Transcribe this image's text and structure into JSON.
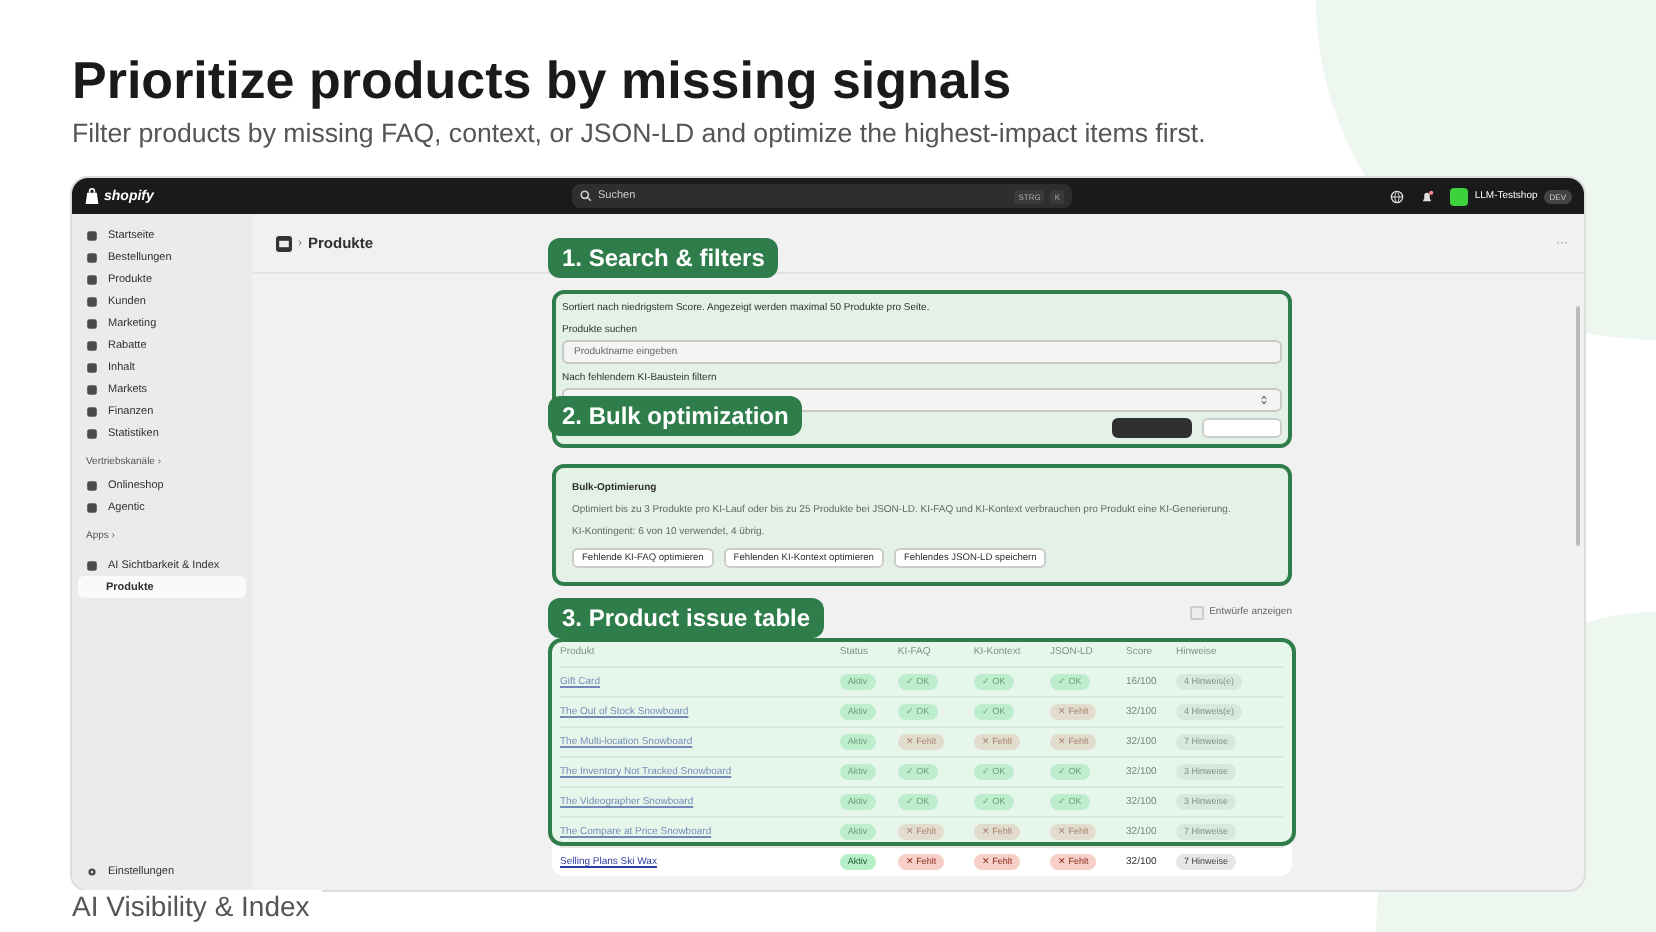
{
  "header": {
    "title": "Prioritize products by missing signals",
    "subtitle": "Filter products by missing FAQ, context, or JSON-LD and optimize the highest-impact items first."
  },
  "topbar": {
    "logo": "shopify",
    "search_placeholder": "Suchen",
    "shortcut": [
      "STRG",
      "K"
    ],
    "store": "LLM-Testshop",
    "store_badge": "DEV"
  },
  "sidebar": {
    "items": [
      {
        "label": "Startseite",
        "selected": false
      },
      {
        "label": "Bestellungen",
        "selected": false
      },
      {
        "label": "Produkte",
        "selected": false
      },
      {
        "label": "Kunden",
        "selected": false
      },
      {
        "label": "Marketing",
        "selected": false
      },
      {
        "label": "Rabatte",
        "selected": false
      },
      {
        "label": "Inhalt",
        "selected": false
      },
      {
        "label": "Markets",
        "selected": false
      },
      {
        "label": "Finanzen",
        "selected": false
      },
      {
        "label": "Statistiken",
        "selected": false
      }
    ],
    "channels_heading": "Vertriebskanäle ›",
    "channels": [
      {
        "label": "Onlineshop",
        "selected": false
      },
      {
        "label": "Agentic",
        "selected": false
      }
    ],
    "apps_heading": "Apps ›",
    "app": {
      "label": "AI Sichtbarkeit & Index",
      "children": [
        {
          "label": "Produkte",
          "selected": true
        }
      ]
    },
    "settings": "Einstellungen"
  },
  "breadcrumb_separator": "›",
  "breadcrumb": "Produkte",
  "more": "···",
  "filters": {
    "note": "Sortiert nach niedrigstem Score. Angezeigt werden maximal 50 Produkte pro Seite.",
    "search_label": "Produkte suchen",
    "search_placeholder": "Produktname eingeben",
    "filter_label": "Nach fehlendem KI-Baustein filtern"
  },
  "bulk": {
    "title": "Bulk-Optimierung",
    "description": "Optimiert bis zu 3 Produkte pro KI-Lauf oder bis zu 25 Produkte bei JSON-LD. KI-FAQ und KI-Kontext verbrauchen pro Produkt eine KI-Generierung.",
    "quota": "KI-Kontingent: 6 von 10 verwendet, 4 übrig.",
    "buttons": [
      "Fehlende KI-FAQ optimieren",
      "Fehlenden KI-Kontext optimieren",
      "Fehlendes JSON-LD speichern"
    ]
  },
  "drafts": {
    "label": "Entwürfe anzeigen",
    "checked": false
  },
  "table": {
    "columns": [
      "Produkt",
      "Status",
      "KI-FAQ",
      "KI-Kontext",
      "JSON-LD",
      "Score",
      "Hinweise"
    ],
    "rows": [
      {
        "product": "Gift Card",
        "status": "Aktiv",
        "faq": {
          "text": "✓ OK",
          "ok": true
        },
        "context": {
          "text": "✓ OK",
          "ok": true
        },
        "jsonld": {
          "text": "✓ OK",
          "ok": true
        },
        "score": "16/100",
        "hints": "4 Hinweis(e)"
      },
      {
        "product": "The Out of Stock Snowboard",
        "status": "Aktiv",
        "faq": {
          "text": "✓ OK",
          "ok": true
        },
        "context": {
          "text": "✓ OK",
          "ok": true
        },
        "jsonld": {
          "text": "✕ Fehlt",
          "ok": false
        },
        "score": "32/100",
        "hints": "4 Hinweis(e)"
      },
      {
        "product": "The Multi-location Snowboard",
        "status": "Aktiv",
        "faq": {
          "text": "✕ Fehlt",
          "ok": false
        },
        "context": {
          "text": "✕ Fehlt",
          "ok": false
        },
        "jsonld": {
          "text": "✕ Fehlt",
          "ok": false
        },
        "score": "32/100",
        "hints": "7 Hinweise"
      },
      {
        "product": "The Inventory Not Tracked Snowboard",
        "status": "Aktiv",
        "faq": {
          "text": "✓ OK",
          "ok": true
        },
        "context": {
          "text": "✓ OK",
          "ok": true
        },
        "jsonld": {
          "text": "✓ OK",
          "ok": true
        },
        "score": "32/100",
        "hints": "3 Hinweise"
      },
      {
        "product": "The Videographer Snowboard",
        "status": "Aktiv",
        "faq": {
          "text": "✓ OK",
          "ok": true
        },
        "context": {
          "text": "✓ OK",
          "ok": true
        },
        "jsonld": {
          "text": "✓ OK",
          "ok": true
        },
        "score": "32/100",
        "hints": "3 Hinweise"
      },
      {
        "product": "The Compare at Price Snowboard",
        "status": "Aktiv",
        "faq": {
          "text": "✕ Fehlt",
          "ok": false
        },
        "context": {
          "text": "✕ Fehlt",
          "ok": false
        },
        "jsonld": {
          "text": "✕ Fehlt",
          "ok": false
        },
        "score": "32/100",
        "hints": "7 Hinweise"
      },
      {
        "product": "Selling Plans Ski Wax",
        "status": "Aktiv",
        "faq": {
          "text": "✕ Fehlt",
          "ok": false
        },
        "context": {
          "text": "✕ Fehlt",
          "ok": false
        },
        "jsonld": {
          "text": "✕ Fehlt",
          "ok": false
        },
        "score": "32/100",
        "hints": "7 Hinweise"
      }
    ]
  },
  "callouts": [
    {
      "label": "1. Search & filters"
    },
    {
      "label": "2. Bulk optimization"
    },
    {
      "label": "3. Product issue table"
    }
  ],
  "footer_label": "AI Visibility & Index"
}
